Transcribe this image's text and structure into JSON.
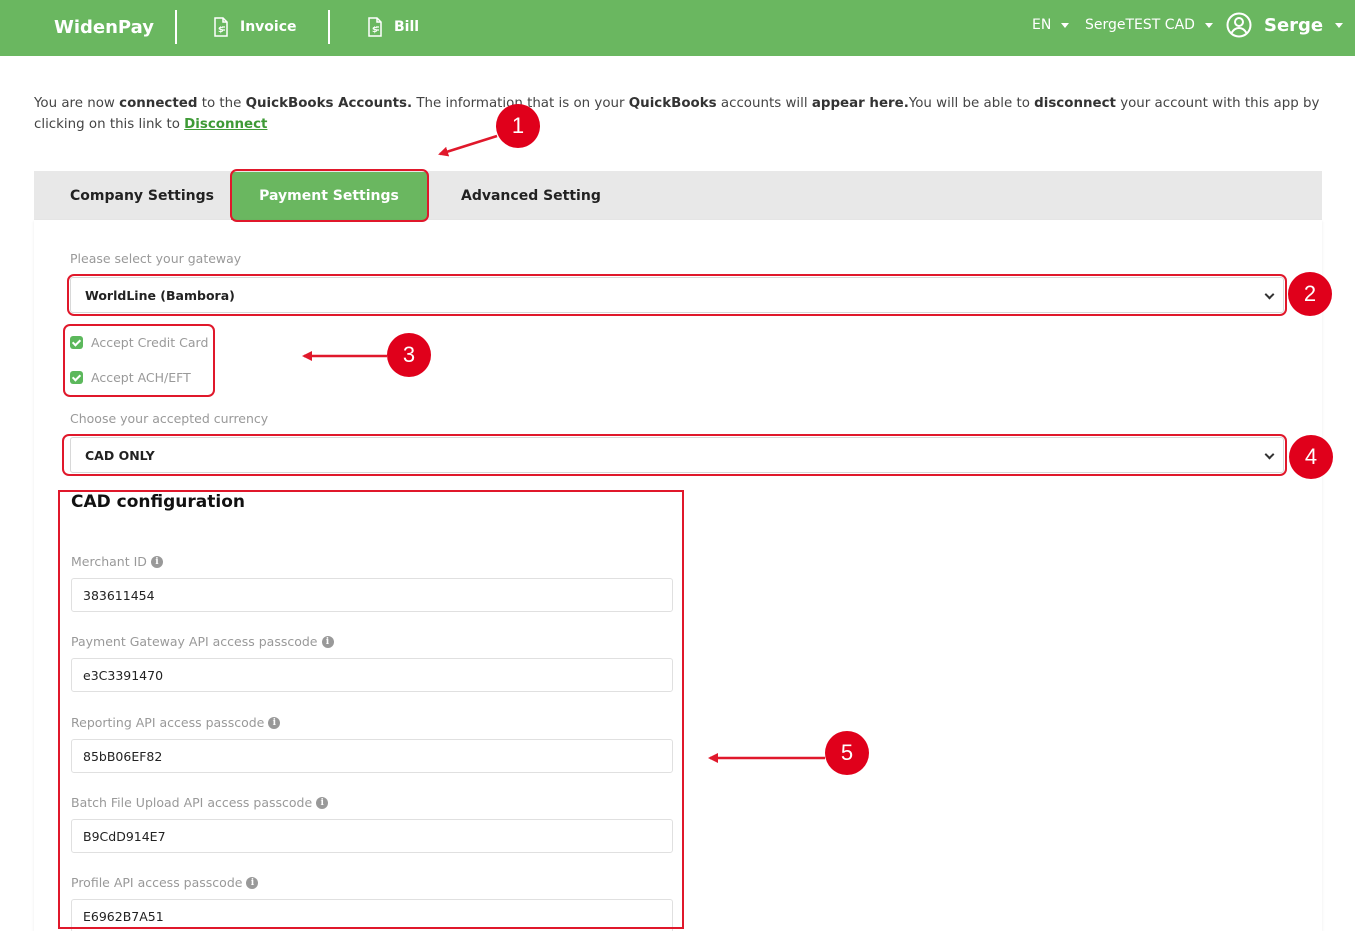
{
  "header": {
    "brand": "WidenPay",
    "nav": [
      {
        "label": "Invoice"
      },
      {
        "label": "Bill"
      }
    ],
    "language": "EN",
    "tenant": "SergeTEST CAD",
    "user": "Serge"
  },
  "intro": {
    "t1": "You are now ",
    "b1": "connected",
    "t2": " to the ",
    "b2": "QuickBooks Accounts.",
    "t3": " The information that is on your ",
    "b3": "QuickBooks",
    "t4": " accounts will ",
    "b4": "appear here.",
    "t5": "You will be able to ",
    "b5": "disconnect",
    "t6": " your account with this app by clicking on this link to ",
    "link": "Disconnect"
  },
  "tabs": [
    {
      "label": "Company Settings",
      "active": false
    },
    {
      "label": "Payment Settings",
      "active": true
    },
    {
      "label": "Advanced Setting",
      "active": false
    }
  ],
  "gateway": {
    "label": "Please select your gateway",
    "value": "WorldLine (Bambora)"
  },
  "options": {
    "credit_card": {
      "label": "Accept Credit Card",
      "checked": true
    },
    "ach": {
      "label": "Accept ACH/EFT",
      "checked": true
    }
  },
  "currency": {
    "label": "Choose your accepted currency",
    "value": "CAD ONLY"
  },
  "config": {
    "title": "CAD configuration",
    "fields": [
      {
        "label": "Merchant ID",
        "value": "383611454"
      },
      {
        "label": "Payment Gateway API access passcode",
        "value": "e3C3391470"
      },
      {
        "label": "Reporting API access passcode",
        "value": "85bB06EF82"
      },
      {
        "label": "Batch File Upload API access passcode",
        "value": "B9CdD914E7"
      },
      {
        "label": "Profile API access passcode",
        "value": "E6962B7A51"
      }
    ]
  },
  "annotations": [
    "1",
    "2",
    "3",
    "4",
    "5"
  ],
  "colors": {
    "header_green": "#6ab760",
    "link_green": "#3e9a36",
    "annotation_red": "#e0182b"
  }
}
